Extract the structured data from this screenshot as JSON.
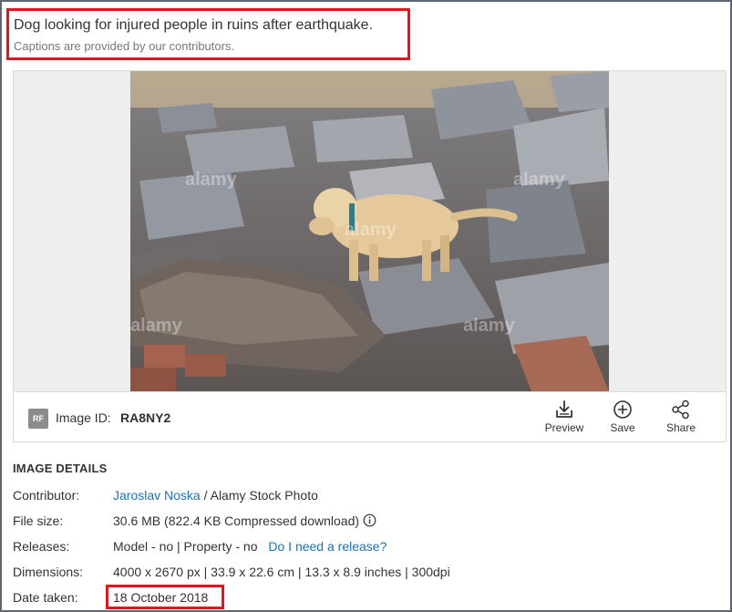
{
  "caption": {
    "title": "Dog looking for injured people in ruins after earthquake.",
    "subtitle": "Captions are provided by our contributors."
  },
  "photo": {
    "alt": "Dog looking for injured people in ruins after earthquake",
    "watermark": "alamy"
  },
  "toolbar": {
    "badge": "RF",
    "image_id_label": "Image ID:",
    "image_id_value": "RA8NY2",
    "preview_label": "Preview",
    "save_label": "Save",
    "share_label": "Share"
  },
  "details": {
    "heading": "IMAGE DETAILS",
    "contributor_label": "Contributor:",
    "contributor_name": "Jaroslav Noska",
    "contributor_suffix": " / Alamy Stock Photo",
    "filesize_label": "File size:",
    "filesize_value": "30.6 MB (822.4 KB Compressed download)",
    "releases_label": "Releases:",
    "releases_value": "Model - no | Property - no ",
    "releases_link": "Do I need a release?",
    "dimensions_label": "Dimensions:",
    "dimensions_value": "4000 x 2670 px | 33.9 x 22.6 cm | 13.3 x 8.9 inches | 300dpi",
    "date_label": "Date taken:",
    "date_value": "18 October 2018"
  },
  "colors": {
    "highlight": "#e1151d",
    "link": "#1a73b8",
    "frame": "#5c6873"
  }
}
